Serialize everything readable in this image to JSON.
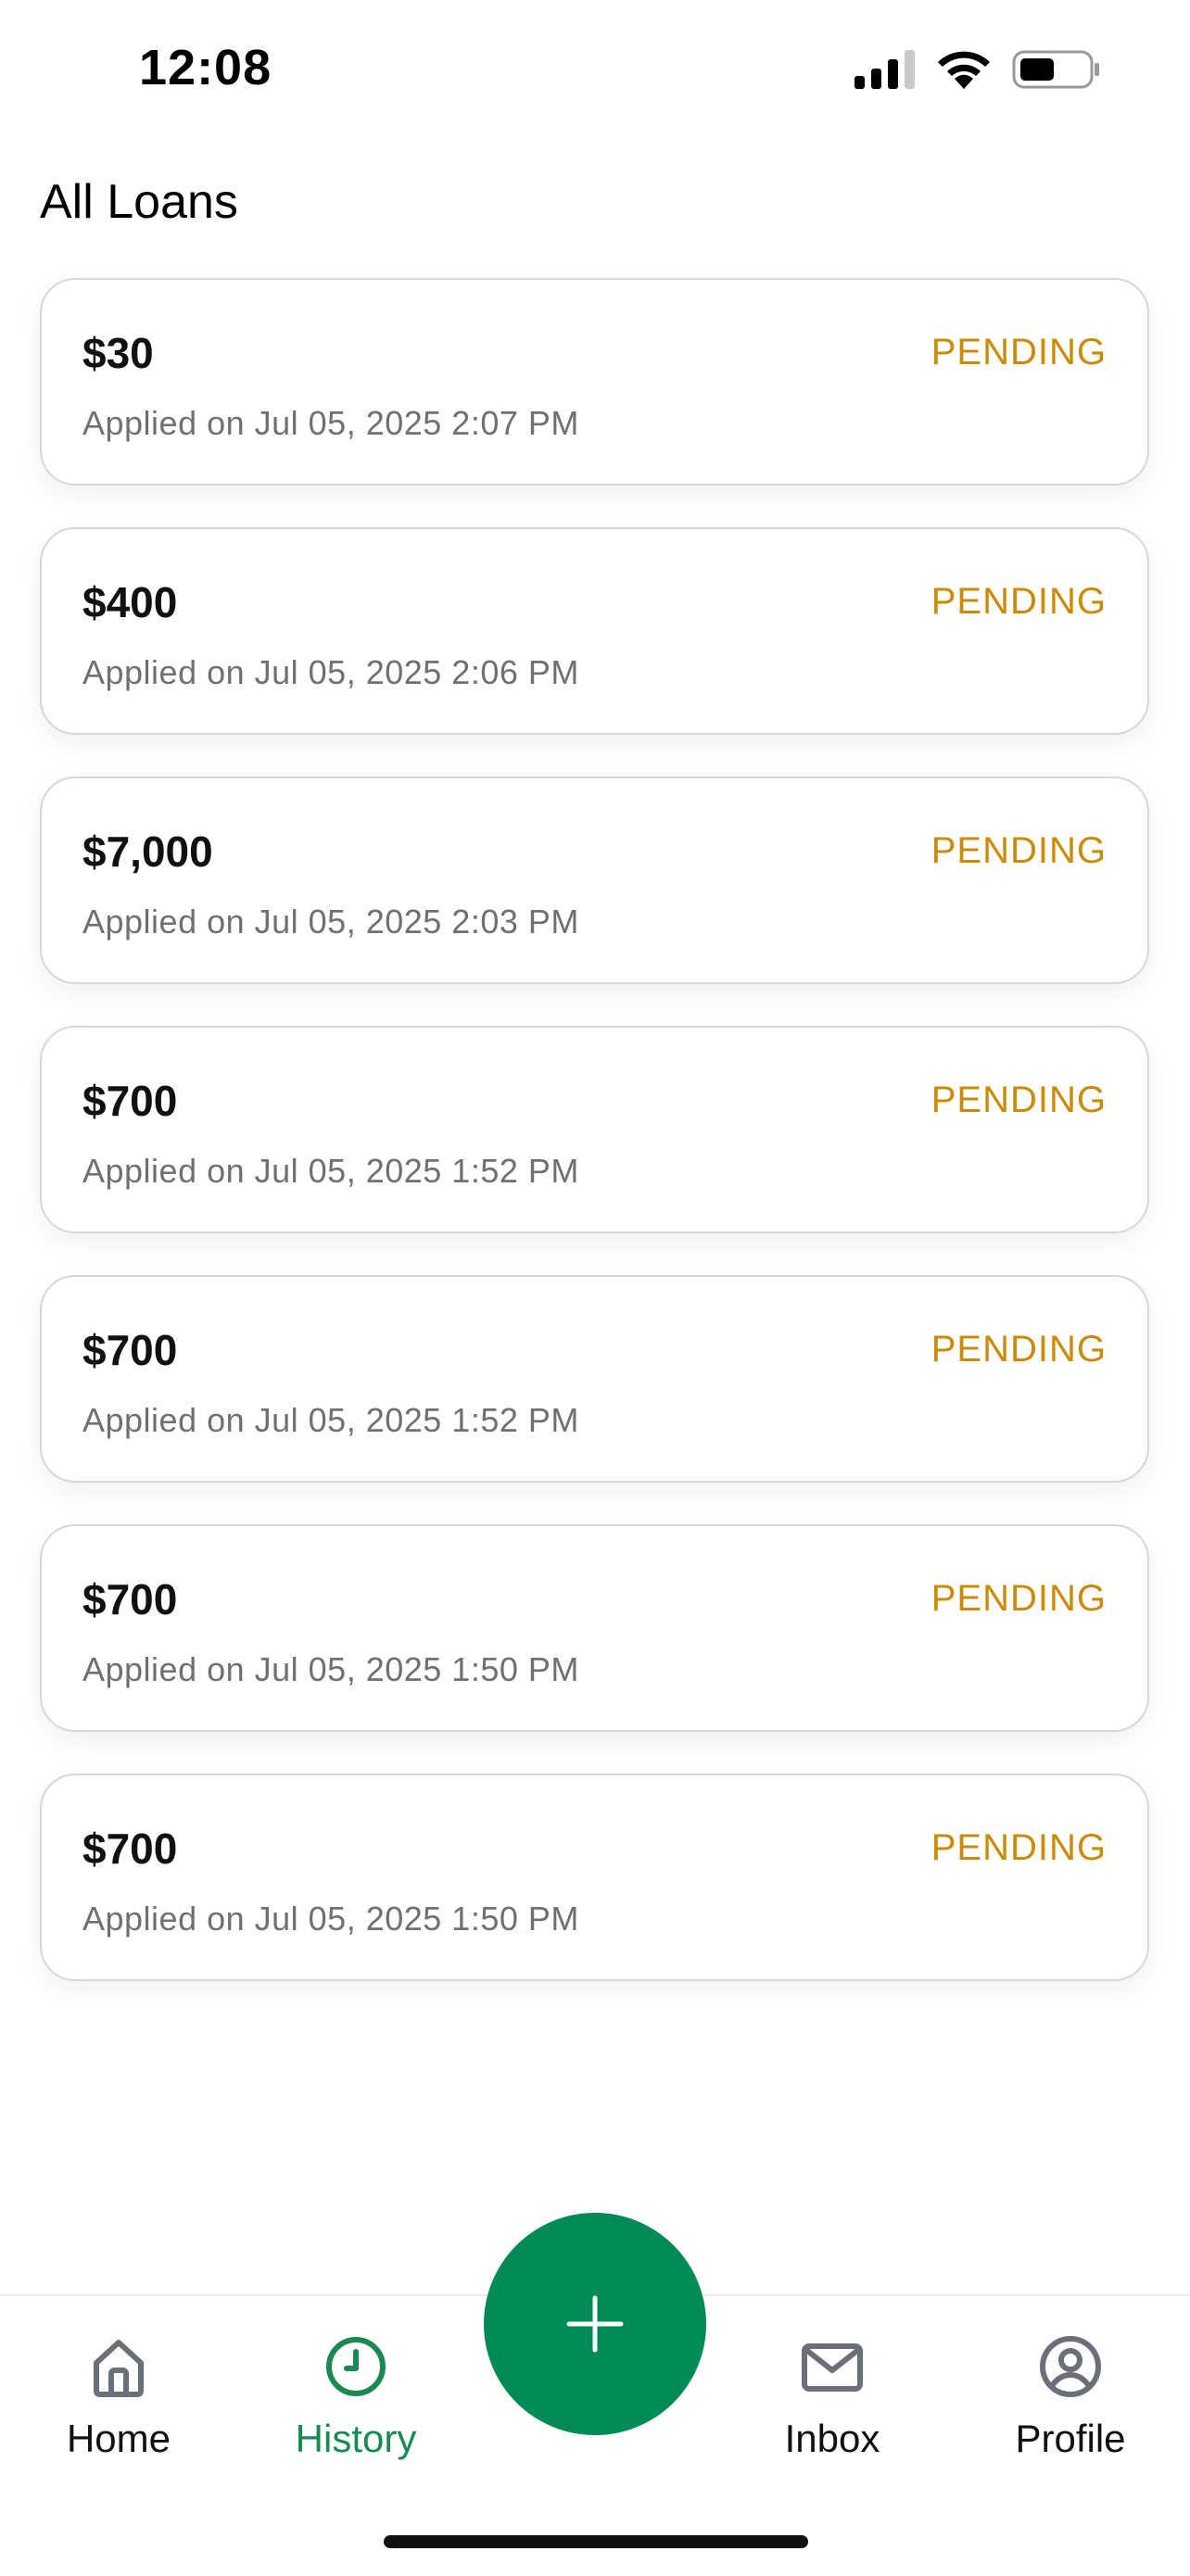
{
  "status_bar": {
    "time": "12:08"
  },
  "page": {
    "title": "All Loans"
  },
  "colors": {
    "accent": "#008a55",
    "active_tab": "#1a8a55",
    "pending": "#cc8a06"
  },
  "loans": [
    {
      "amount": "$30",
      "status": "PENDING",
      "applied": "Applied on Jul 05, 2025 2:07 PM"
    },
    {
      "amount": "$400",
      "status": "PENDING",
      "applied": "Applied on Jul 05, 2025 2:06 PM"
    },
    {
      "amount": "$7,000",
      "status": "PENDING",
      "applied": "Applied on Jul 05, 2025 2:03 PM"
    },
    {
      "amount": "$700",
      "status": "PENDING",
      "applied": "Applied on Jul 05, 2025 1:52 PM"
    },
    {
      "amount": "$700",
      "status": "PENDING",
      "applied": "Applied on Jul 05, 2025 1:52 PM"
    },
    {
      "amount": "$700",
      "status": "PENDING",
      "applied": "Applied on Jul 05, 2025 1:50 PM"
    },
    {
      "amount": "$700",
      "status": "PENDING",
      "applied": "Applied on Jul 05, 2025 1:50 PM"
    }
  ],
  "tab_bar": {
    "tabs": [
      {
        "label": "Home",
        "icon": "home-icon",
        "active": false
      },
      {
        "label": "History",
        "icon": "clock-icon",
        "active": true
      },
      {
        "label": "Inbox",
        "icon": "mail-icon",
        "active": false
      },
      {
        "label": "Profile",
        "icon": "user-circle-icon",
        "active": false
      }
    ],
    "fab_icon": "plus-icon"
  }
}
